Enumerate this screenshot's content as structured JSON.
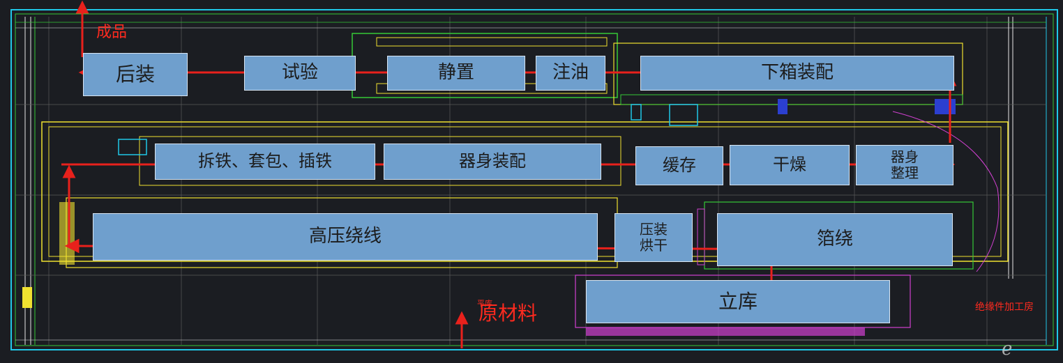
{
  "colors": {
    "background": "#1b1d22",
    "zone_fill": "#6f9fcd",
    "flow_arrow": "#e8211c",
    "cad_yellow": "#f0e130",
    "cad_green": "#36c936",
    "cad_cyan": "#20c8e8",
    "cad_magenta": "#d040d0"
  },
  "zones": {
    "houzhuang": "后装",
    "shiyan": "试验",
    "jingzhi": "静置",
    "zhuyou": "注油",
    "xiaxiang": "下箱装配",
    "chaitie": "拆铁、套包、插铁",
    "qishen_zhuangpei": "器身装配",
    "huancun": "缓存",
    "ganzao": "干燥",
    "qishen_zhengli": "器身\n整理",
    "gaoya": "高压绕线",
    "yazhuang": "压装\n烘干",
    "boraо": "箔绕",
    "liku": "立库"
  },
  "labels": {
    "chengpin": "成品",
    "yuancailiao": "原材料",
    "pingku": "平库",
    "jueyuan": "绝缘件加工房"
  },
  "icons": {
    "watermark": "e-watermark-icon"
  }
}
